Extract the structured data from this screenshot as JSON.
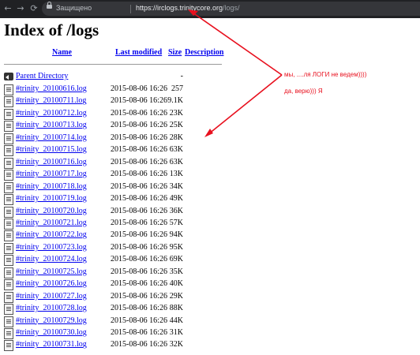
{
  "browser": {
    "security_label": "Защищено",
    "url_host": "https://irclogs.trinitycore.org",
    "url_path": "/logs/"
  },
  "page": {
    "title": "Index of /logs",
    "columns": {
      "name": "Name",
      "last_modified": "Last modified",
      "size": "Size",
      "description": "Description"
    },
    "parent": {
      "label": "Parent Directory",
      "size": "-"
    },
    "files": [
      {
        "name": "#trinity_20100616.log",
        "date": "2015-08-06 16:26",
        "size": "257"
      },
      {
        "name": "#trinity_20100711.log",
        "date": "2015-08-06 16:26",
        "size": "9.1K"
      },
      {
        "name": "#trinity_20100712.log",
        "date": "2015-08-06 16:26",
        "size": "23K"
      },
      {
        "name": "#trinity_20100713.log",
        "date": "2015-08-06 16:26",
        "size": "25K"
      },
      {
        "name": "#trinity_20100714.log",
        "date": "2015-08-06 16:26",
        "size": "28K"
      },
      {
        "name": "#trinity_20100715.log",
        "date": "2015-08-06 16:26",
        "size": "63K"
      },
      {
        "name": "#trinity_20100716.log",
        "date": "2015-08-06 16:26",
        "size": "63K"
      },
      {
        "name": "#trinity_20100717.log",
        "date": "2015-08-06 16:26",
        "size": "13K"
      },
      {
        "name": "#trinity_20100718.log",
        "date": "2015-08-06 16:26",
        "size": "34K"
      },
      {
        "name": "#trinity_20100719.log",
        "date": "2015-08-06 16:26",
        "size": "49K"
      },
      {
        "name": "#trinity_20100720.log",
        "date": "2015-08-06 16:26",
        "size": "36K"
      },
      {
        "name": "#trinity_20100721.log",
        "date": "2015-08-06 16:26",
        "size": "57K"
      },
      {
        "name": "#trinity_20100722.log",
        "date": "2015-08-06 16:26",
        "size": "94K"
      },
      {
        "name": "#trinity_20100723.log",
        "date": "2015-08-06 16:26",
        "size": "95K"
      },
      {
        "name": "#trinity_20100724.log",
        "date": "2015-08-06 16:26",
        "size": "69K"
      },
      {
        "name": "#trinity_20100725.log",
        "date": "2015-08-06 16:26",
        "size": "35K"
      },
      {
        "name": "#trinity_20100726.log",
        "date": "2015-08-06 16:26",
        "size": "40K"
      },
      {
        "name": "#trinity_20100727.log",
        "date": "2015-08-06 16:26",
        "size": "29K"
      },
      {
        "name": "#trinity_20100728.log",
        "date": "2015-08-06 16:26",
        "size": "88K"
      },
      {
        "name": "#trinity_20100729.log",
        "date": "2015-08-06 16:26",
        "size": "44K"
      },
      {
        "name": "#trinity_20100730.log",
        "date": "2015-08-06 16:26",
        "size": "31K"
      },
      {
        "name": "#trinity_20100731.log",
        "date": "2015-08-06 16:26",
        "size": "32K"
      }
    ]
  },
  "annotations": {
    "line1": "мы, ....ля ЛОГИ не ведем))))",
    "line2": "да, верю))) Я",
    "color": "#e8101e"
  }
}
